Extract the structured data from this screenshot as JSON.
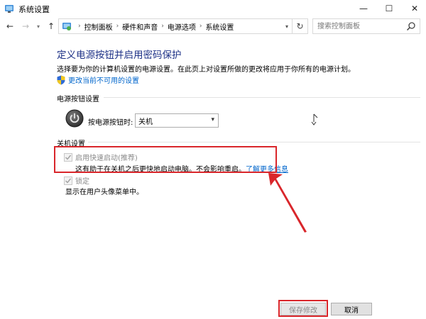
{
  "window": {
    "title": "系统设置",
    "controls": {
      "minimize": "—",
      "maximize": "☐",
      "close": "✕"
    }
  },
  "navigation": {
    "back": "←",
    "forward": "→",
    "recent": "▾",
    "up": "↑",
    "breadcrumbs": [
      "控制面板",
      "硬件和声音",
      "电源选项",
      "系统设置"
    ],
    "separator": "›",
    "address_dropdown": "▾",
    "refresh": "↻",
    "search_placeholder": "搜索控制面板"
  },
  "page": {
    "heading": "定义电源按钮并启用密码保护",
    "description": "选择要为你的计算机设置的电源设置。在此页上对设置所做的更改将应用于你所有的电源计划。",
    "admin_link": "更改当前不可用的设置"
  },
  "power_button": {
    "section_label": "电源按钮设置",
    "field_label": "按电源按钮时:",
    "selected_value": "关机",
    "dropdown_arrow": "▾"
  },
  "shutdown": {
    "section_label": "关机设置",
    "fast_startup": {
      "label": "启用快速启动(推荐)",
      "checked": true,
      "enabled": false,
      "description": "这有助于在关机之后更快地启动电脑。不会影响重启。",
      "learn_more": "了解更多信息"
    },
    "lock": {
      "label": "锁定",
      "checked": true,
      "enabled": false,
      "description": "显示在用户头像菜单中。"
    }
  },
  "footer": {
    "save_label": "保存修改",
    "cancel_label": "取消"
  },
  "colors": {
    "heading": "#1e3287",
    "link": "#0066cc",
    "annotation": "#d9262b"
  }
}
